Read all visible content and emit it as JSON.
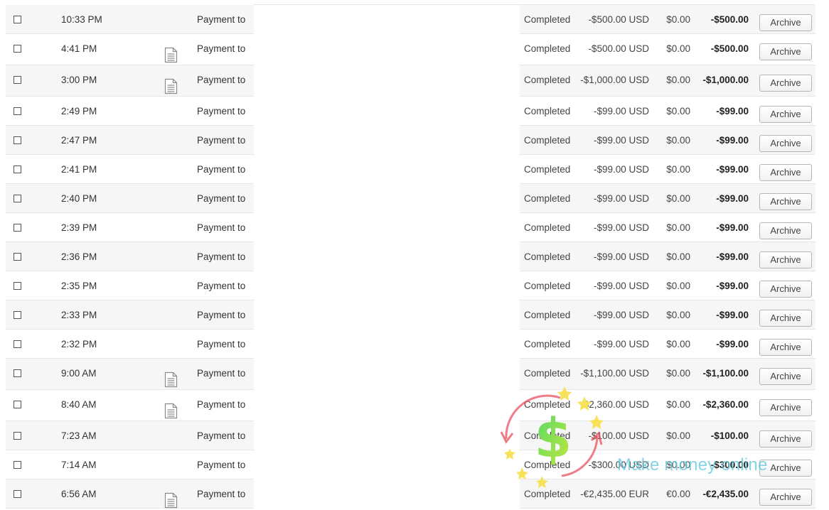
{
  "transactions": [
    {
      "time": "10:33 PM",
      "has_doc": false,
      "description": "Payment to",
      "status": "Completed",
      "gross": "-$500.00 USD",
      "fee": "$0.00",
      "net": "-$500.00",
      "action": "Archive"
    },
    {
      "time": "4:41 PM",
      "has_doc": true,
      "description": "Payment to",
      "status": "Completed",
      "gross": "-$500.00 USD",
      "fee": "$0.00",
      "net": "-$500.00",
      "action": "Archive"
    },
    {
      "time": "3:00 PM",
      "has_doc": true,
      "description": "Payment to",
      "status": "Completed",
      "gross": "-$1,000.00 USD",
      "fee": "$0.00",
      "net": "-$1,000.00",
      "action": "Archive"
    },
    {
      "time": "2:49 PM",
      "has_doc": false,
      "description": "Payment to",
      "status": "Completed",
      "gross": "-$99.00 USD",
      "fee": "$0.00",
      "net": "-$99.00",
      "action": "Archive"
    },
    {
      "time": "2:47 PM",
      "has_doc": false,
      "description": "Payment to",
      "status": "Completed",
      "gross": "-$99.00 USD",
      "fee": "$0.00",
      "net": "-$99.00",
      "action": "Archive"
    },
    {
      "time": "2:41 PM",
      "has_doc": false,
      "description": "Payment to",
      "status": "Completed",
      "gross": "-$99.00 USD",
      "fee": "$0.00",
      "net": "-$99.00",
      "action": "Archive"
    },
    {
      "time": "2:40 PM",
      "has_doc": false,
      "description": "Payment to",
      "status": "Completed",
      "gross": "-$99.00 USD",
      "fee": "$0.00",
      "net": "-$99.00",
      "action": "Archive"
    },
    {
      "time": "2:39 PM",
      "has_doc": false,
      "description": "Payment to",
      "status": "Completed",
      "gross": "-$99.00 USD",
      "fee": "$0.00",
      "net": "-$99.00",
      "action": "Archive"
    },
    {
      "time": "2:36 PM",
      "has_doc": false,
      "description": "Payment to",
      "status": "Completed",
      "gross": "-$99.00 USD",
      "fee": "$0.00",
      "net": "-$99.00",
      "action": "Archive"
    },
    {
      "time": "2:35 PM",
      "has_doc": false,
      "description": "Payment to",
      "status": "Completed",
      "gross": "-$99.00 USD",
      "fee": "$0.00",
      "net": "-$99.00",
      "action": "Archive"
    },
    {
      "time": "2:33 PM",
      "has_doc": false,
      "description": "Payment to",
      "status": "Completed",
      "gross": "-$99.00 USD",
      "fee": "$0.00",
      "net": "-$99.00",
      "action": "Archive"
    },
    {
      "time": "2:32 PM",
      "has_doc": false,
      "description": "Payment to",
      "status": "Completed",
      "gross": "-$99.00 USD",
      "fee": "$0.00",
      "net": "-$99.00",
      "action": "Archive"
    },
    {
      "time": "9:00 AM",
      "has_doc": true,
      "description": "Payment to",
      "status": "Completed",
      "gross": "-$1,100.00 USD",
      "fee": "$0.00",
      "net": "-$1,100.00",
      "action": "Archive"
    },
    {
      "time": "8:40 AM",
      "has_doc": true,
      "description": "Payment to",
      "status": "Completed",
      "gross": "-$2,360.00 USD",
      "fee": "$0.00",
      "net": "-$2,360.00",
      "action": "Archive"
    },
    {
      "time": "7:23 AM",
      "has_doc": false,
      "description": "Payment to",
      "status": "Completed",
      "gross": "-$100.00 USD",
      "fee": "$0.00",
      "net": "-$100.00",
      "action": "Archive"
    },
    {
      "time": "7:14 AM",
      "has_doc": false,
      "description": "Payment to",
      "status": "Completed",
      "gross": "-$300.00 USD",
      "fee": "$0.00",
      "net": "-$300.00",
      "action": "Archive"
    },
    {
      "time": "6:56 AM",
      "has_doc": true,
      "description": "Payment to",
      "status": "Completed",
      "gross": "-€2,435.00 EUR",
      "fee": "€0.00",
      "net": "-€2,435.00",
      "action": "Archive"
    }
  ],
  "watermark": {
    "text": "Make money online",
    "icon": "dollar-coin-icon"
  },
  "colors": {
    "row_alt_bg": "#f6f6f6",
    "divider": "#e6e6e6",
    "watermark_text": "#60c8dc"
  }
}
